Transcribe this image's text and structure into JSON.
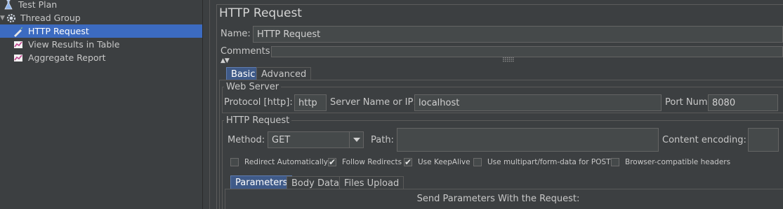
{
  "tree": {
    "items": [
      {
        "label": "Test Plan",
        "icon": "test-plan-icon"
      },
      {
        "label": "Thread Group",
        "icon": "thread-group-icon"
      },
      {
        "label": "HTTP Request",
        "icon": "http-request-icon",
        "selected": true
      },
      {
        "label": "View Results in Table",
        "icon": "listener-icon"
      },
      {
        "label": "Aggregate Report",
        "icon": "listener-icon"
      }
    ]
  },
  "panel": {
    "title": "HTTP Request",
    "name_label": "Name:",
    "name_value": "HTTP Request",
    "comments_label": "Comments:",
    "comments_value": "",
    "tabs": [
      "Basic",
      "Advanced"
    ],
    "web_server": {
      "title": "Web Server",
      "protocol_label": "Protocol [http]:",
      "protocol_value": "http",
      "server_label": "Server Name or IP:",
      "server_value": "localhost",
      "port_label": "Port Number:",
      "port_value": "8080"
    },
    "http_request": {
      "title": "HTTP Request",
      "method_label": "Method:",
      "method_value": "GET",
      "path_label": "Path:",
      "path_value": "",
      "encoding_label": "Content encoding:",
      "encoding_value": "",
      "checkboxes": [
        {
          "label": "Redirect Automatically",
          "checked": false
        },
        {
          "label": "Follow Redirects",
          "checked": true
        },
        {
          "label": "Use KeepAlive",
          "checked": true
        },
        {
          "label": "Use multipart/form-data for POST",
          "checked": false
        },
        {
          "label": "Browser-compatible headers",
          "checked": false
        }
      ],
      "subtabs": [
        "Parameters",
        "Body Data",
        "Files Upload"
      ],
      "params_header": "Send Parameters With the Request:"
    }
  },
  "colors": {
    "background": "#3c3f41",
    "selection": "#3c6bc1",
    "active_tab": "#3f5a88"
  }
}
